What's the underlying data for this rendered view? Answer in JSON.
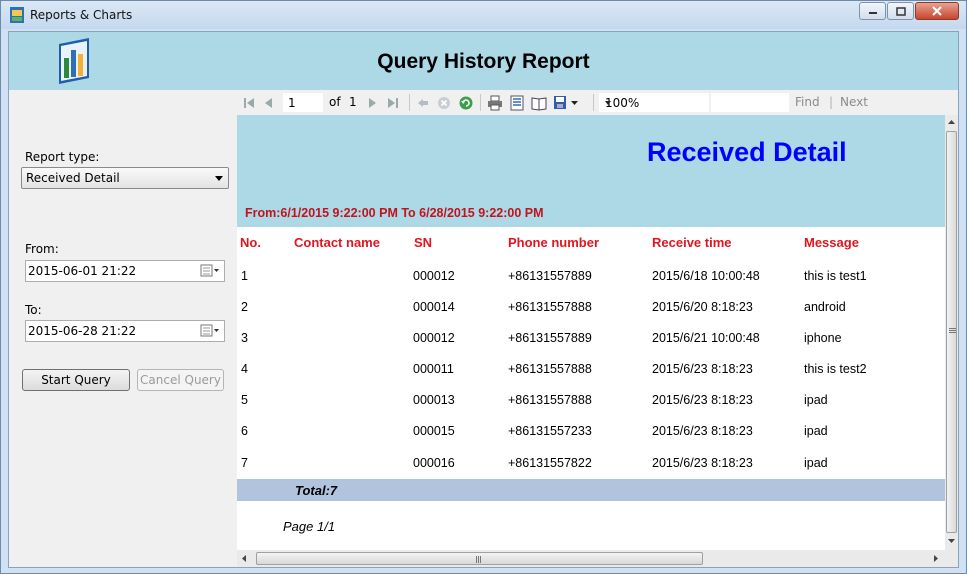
{
  "window": {
    "title": "Reports & Charts"
  },
  "header": {
    "title": "Query History Report"
  },
  "left_panel": {
    "report_type_label": "Report type:",
    "report_type_value": "Received Detail",
    "from_label": "From:",
    "from_value": "2015-06-01 21:22",
    "to_label": "To:",
    "to_value": "2015-06-28 21:22",
    "start_query_label": "Start Query",
    "cancel_query_label": "Cancel Query"
  },
  "toolbar": {
    "current_page": "1",
    "of_label": "of",
    "total_pages": "1",
    "zoom": "100%",
    "find_label": "Find",
    "separator": "|",
    "next_label": "Next"
  },
  "report": {
    "title": "Received Detail",
    "date_range": "From:6/1/2015 9:22:00 PM To 6/28/2015 9:22:00 PM",
    "columns": [
      "No.",
      "Contact name",
      "SN",
      "Phone number",
      "Receive time",
      "Message"
    ],
    "rows": [
      {
        "no": "1",
        "contact": "",
        "sn": "000012",
        "phone": "+86131557889",
        "time": "2015/6/18 10:00:48",
        "message": "this is test1"
      },
      {
        "no": "2",
        "contact": "",
        "sn": "000014",
        "phone": "+86131557888",
        "time": "2015/6/20 8:18:23",
        "message": "android"
      },
      {
        "no": "3",
        "contact": "",
        "sn": "000012",
        "phone": "+86131557889",
        "time": "2015/6/21 10:00:48",
        "message": "iphone"
      },
      {
        "no": "4",
        "contact": "",
        "sn": "000011",
        "phone": "+86131557888",
        "time": "2015/6/23 8:18:23",
        "message": "this is test2"
      },
      {
        "no": "5",
        "contact": "",
        "sn": "000013",
        "phone": "+86131557888",
        "time": "2015/6/23 8:18:23",
        "message": "ipad"
      },
      {
        "no": "6",
        "contact": "",
        "sn": "000015",
        "phone": "+86131557233",
        "time": "2015/6/23 8:18:23",
        "message": "ipad"
      },
      {
        "no": "7",
        "contact": "",
        "sn": "000016",
        "phone": "+86131557822",
        "time": "2015/6/23 8:18:23",
        "message": "ipad"
      }
    ],
    "total": "Total:7",
    "page_footer": "Page 1/1"
  },
  "colors": {
    "header_bg": "#add8e6",
    "report_title": "#0000ff",
    "accent_red": "#e3141f",
    "total_bar": "#b0c4de"
  }
}
